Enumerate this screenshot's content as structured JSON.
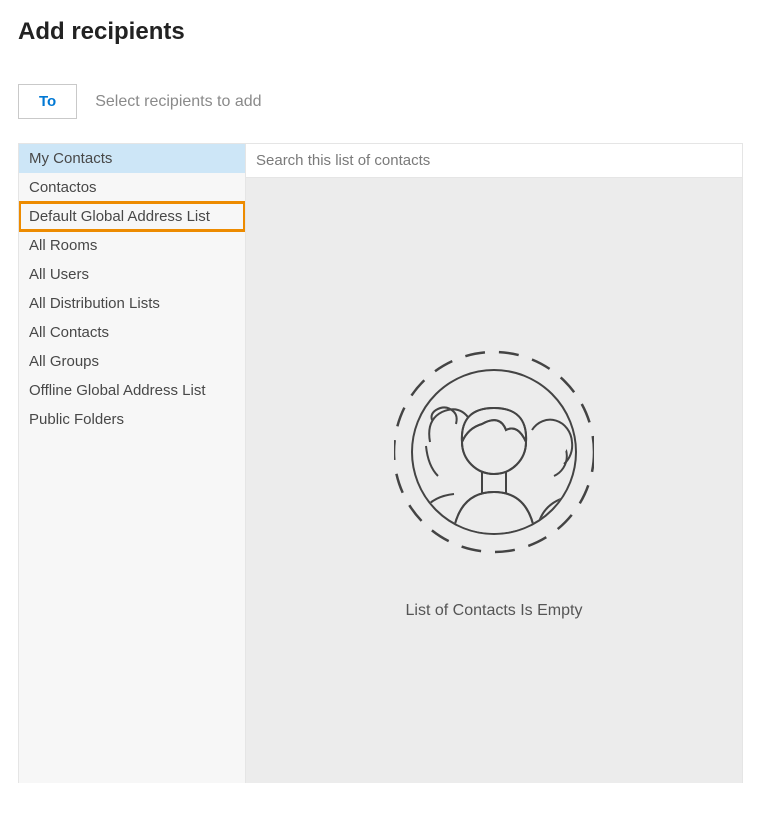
{
  "title": "Add recipients",
  "toButton": "To",
  "recipientPlaceholder": "Select recipients to add",
  "searchPlaceholder": "Search this list of contacts",
  "sidebar": {
    "items": [
      {
        "label": "My Contacts",
        "selected": true,
        "highlighted": false
      },
      {
        "label": "Contactos",
        "selected": false,
        "highlighted": false
      },
      {
        "label": "Default Global Address List",
        "selected": false,
        "highlighted": true
      },
      {
        "label": "All Rooms",
        "selected": false,
        "highlighted": false
      },
      {
        "label": "All Users",
        "selected": false,
        "highlighted": false
      },
      {
        "label": "All Distribution Lists",
        "selected": false,
        "highlighted": false
      },
      {
        "label": "All Contacts",
        "selected": false,
        "highlighted": false
      },
      {
        "label": "All Groups",
        "selected": false,
        "highlighted": false
      },
      {
        "label": "Offline Global Address List",
        "selected": false,
        "highlighted": false
      },
      {
        "label": "Public Folders",
        "selected": false,
        "highlighted": false
      }
    ]
  },
  "emptyMessage": "List of Contacts Is Empty"
}
